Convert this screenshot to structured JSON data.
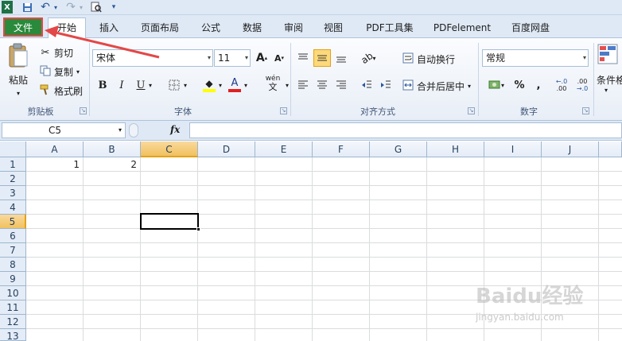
{
  "quick_access": {
    "app_icon": "X",
    "items": [
      {
        "name": "save-icon",
        "glyph": "💾"
      },
      {
        "name": "undo-icon",
        "glyph": "↶"
      },
      {
        "name": "redo-icon",
        "glyph": "↷"
      },
      {
        "name": "print-preview-icon",
        "glyph": "🔍"
      },
      {
        "name": "customize-qat-icon",
        "glyph": "▾"
      }
    ]
  },
  "tabs": {
    "file": "文件",
    "items": [
      "开始",
      "插入",
      "页面布局",
      "公式",
      "数据",
      "审阅",
      "视图",
      "PDF工具集",
      "PDFelement",
      "百度网盘"
    ],
    "active_index": 0
  },
  "clipboard": {
    "paste": "粘贴",
    "cut": "剪切",
    "copy": "复制",
    "format_painter": "格式刷",
    "group_label": "剪贴板"
  },
  "font": {
    "family": "宋体",
    "size": "11",
    "grow": "A",
    "shrink": "A",
    "bold": "B",
    "italic": "I",
    "underline": "U",
    "font_color_glyph": "A",
    "phonetic": "wén",
    "group_label": "字体"
  },
  "alignment": {
    "wrap_text": "自动换行",
    "merge_center": "合并后居中",
    "group_label": "对齐方式"
  },
  "number": {
    "format": "常规",
    "percent": "%",
    "comma": ",",
    "inc_decimal": "←.0 .00",
    "dec_decimal": ".00 →.0",
    "group_label": "数字"
  },
  "styles": {
    "conditional": "条件格"
  },
  "formula_bar": {
    "name_box": "C5",
    "fx": "fx",
    "formula": ""
  },
  "grid": {
    "columns": [
      "A",
      "B",
      "C",
      "D",
      "E",
      "F",
      "G",
      "H",
      "I",
      "J"
    ],
    "rows": [
      "1",
      "2",
      "3",
      "4",
      "5",
      "6",
      "7",
      "8",
      "9",
      "10",
      "11",
      "12",
      "13"
    ],
    "selected_column": "C",
    "selected_row": "5",
    "cells": [
      {
        "ref": "A1",
        "value": "1"
      },
      {
        "ref": "B1",
        "value": "2"
      }
    ]
  },
  "watermark": {
    "logo": "Baidu经验",
    "url": "jingyan.baidu.com"
  },
  "colors": {
    "file_tab": "#2a8a3c",
    "highlight_box": "#e34848",
    "arrow": "#e34848",
    "selection_header": "#f1c15f"
  }
}
